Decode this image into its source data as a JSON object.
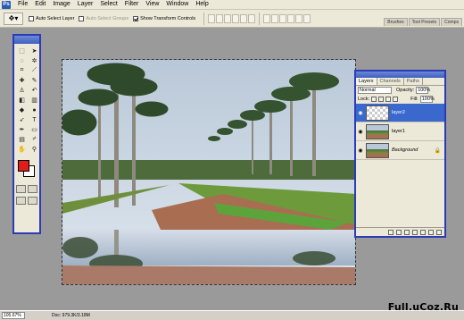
{
  "menu": {
    "items": [
      "File",
      "Edit",
      "Image",
      "Layer",
      "Select",
      "Filter",
      "View",
      "Window",
      "Help"
    ]
  },
  "options_bar": {
    "auto_select_layer": "Auto Select Layer",
    "auto_select_groups": "Auto Select Groups",
    "show_transform_controls": "Show Transform Controls",
    "palette_tabs": [
      "Brushes",
      "Tool Presets",
      "Comps"
    ]
  },
  "toolbox": {
    "foreground_color": "#e21b1b",
    "background_color": "#ffffff"
  },
  "layers_panel": {
    "tabs": [
      "Layers",
      "Channels",
      "Paths"
    ],
    "blend_mode": "Normal",
    "opacity_label": "Opacity:",
    "opacity_value": "100%",
    "lock_label": "Lock:",
    "fill_label": "Fill:",
    "fill_value": "100%",
    "layers": [
      {
        "name": "layer2",
        "selected": true
      },
      {
        "name": "layer1",
        "selected": false
      },
      {
        "name": "Background",
        "selected": false
      }
    ]
  },
  "status": {
    "zoom": "105.67%",
    "doc": "Doc: 979.3K/3.18M"
  },
  "watermark": "Full.uCoz.Ru"
}
